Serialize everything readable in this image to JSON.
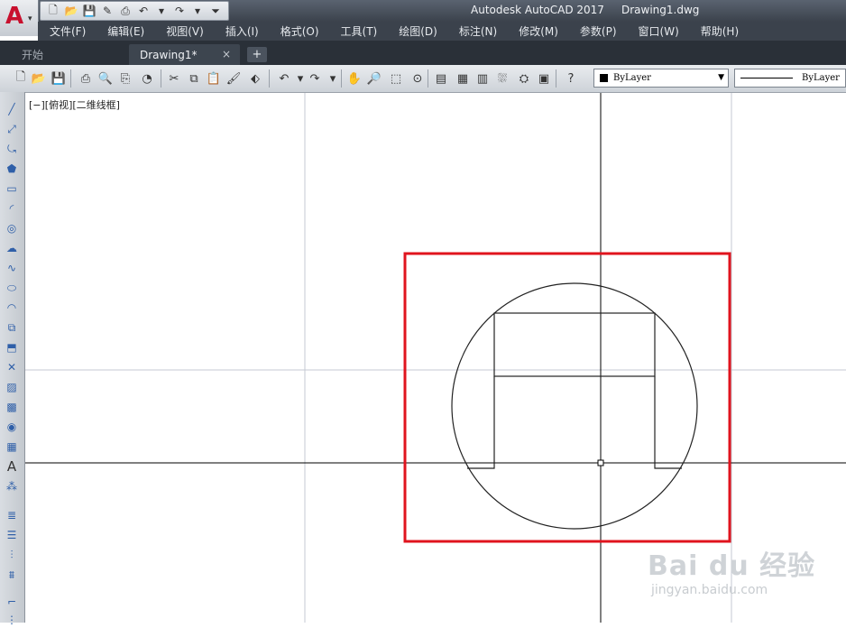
{
  "window": {
    "title": "Autodesk AutoCAD 2017     Drawing1.dwg"
  },
  "app_button": {
    "letter": "A"
  },
  "quick_access": {
    "icons": [
      "new-icon",
      "open-icon",
      "save-icon",
      "save-as-icon",
      "print-icon",
      "undo-icon",
      "redo-icon",
      "customize-icon"
    ]
  },
  "menu": {
    "items": [
      "文件(F)",
      "编辑(E)",
      "视图(V)",
      "插入(I)",
      "格式(O)",
      "工具(T)",
      "绘图(D)",
      "标注(N)",
      "修改(M)",
      "参数(P)",
      "窗口(W)",
      "帮助(H)"
    ]
  },
  "tabs": {
    "start": "开始",
    "drawing": "Drawing1*",
    "close_glyph": "×",
    "add_glyph": "+"
  },
  "toolbar": {
    "layer_value": "ByLayer",
    "linetype_value": "ByLayer"
  },
  "canvas": {
    "viewport_label": "[−][俯视][二维线框]"
  },
  "watermark": {
    "brand": "Bai du 经验",
    "url": "jingyan.baidu.com"
  },
  "colors": {
    "highlight_box": "#e0141e",
    "crosshair": "#000000",
    "grid_line": "#c8ccd4",
    "geometry": "#222222"
  }
}
